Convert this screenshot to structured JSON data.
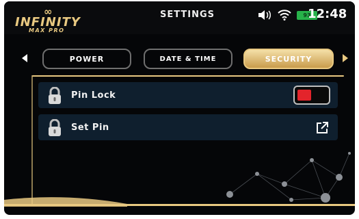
{
  "brand": {
    "logo_symbol": "∞",
    "name": "INFINITY",
    "sub": "MAX PRO"
  },
  "header": {
    "title": "SETTINGS",
    "battery_level": "93",
    "time": "12:48",
    "icons": [
      "volume-icon",
      "wifi-icon",
      "battery-icon"
    ]
  },
  "tabs": [
    {
      "label": "POWER",
      "active": false
    },
    {
      "label": "DATE & TIME",
      "active": false
    },
    {
      "label": "SECURITY",
      "active": true
    }
  ],
  "settings": [
    {
      "label": "Pin Lock",
      "icon": "padlock-icon",
      "control": "toggle",
      "state": "off"
    },
    {
      "label": "Set Pin",
      "icon": "padlock-icon",
      "control": "external-link-icon"
    }
  ],
  "colors": {
    "accent_gold": "#e9c981",
    "toggle_off": "#e3242b",
    "row_bg": "#0f1f2e",
    "battery_green": "#27b24a"
  }
}
